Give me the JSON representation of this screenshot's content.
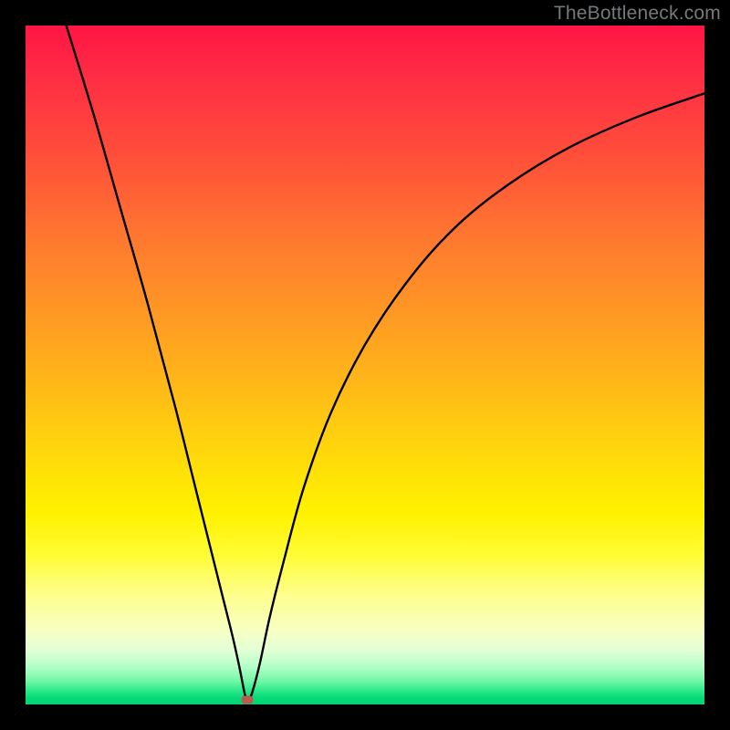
{
  "watermark": "TheBottleneck.com",
  "marker": {
    "x_frac": 0.327,
    "y_frac": 0.993
  },
  "chart_data": {
    "type": "line",
    "title": "",
    "xlabel": "",
    "ylabel": "",
    "xlim": [
      0,
      100
    ],
    "ylim": [
      0,
      100
    ],
    "series": [
      {
        "name": "bottleneck-curve",
        "x": [
          6,
          10,
          14,
          18,
          22,
          25,
          27,
          29,
          30.5,
          31.5,
          32.3,
          32.7,
          33.3,
          34.5,
          36,
          38,
          41,
          45,
          50,
          56,
          63,
          71,
          80,
          90,
          100
        ],
        "y": [
          100,
          87,
          73,
          59,
          44,
          32,
          24,
          16,
          10,
          5.5,
          1.5,
          0.5,
          1.5,
          6,
          13,
          21,
          32,
          43,
          53,
          62,
          70,
          76.5,
          82,
          86.5,
          90
        ]
      }
    ],
    "marker_point": {
      "x": 32.7,
      "y": 0.7
    },
    "background_gradient": {
      "direction": "vertical",
      "stops": [
        {
          "pos": 0.0,
          "color": "#ff1545"
        },
        {
          "pos": 0.2,
          "color": "#ff5139"
        },
        {
          "pos": 0.45,
          "color": "#ffa021"
        },
        {
          "pos": 0.72,
          "color": "#fff200"
        },
        {
          "pos": 0.88,
          "color": "#f8ffc2"
        },
        {
          "pos": 0.96,
          "color": "#74f8a6"
        },
        {
          "pos": 1.0,
          "color": "#00d474"
        }
      ]
    }
  }
}
